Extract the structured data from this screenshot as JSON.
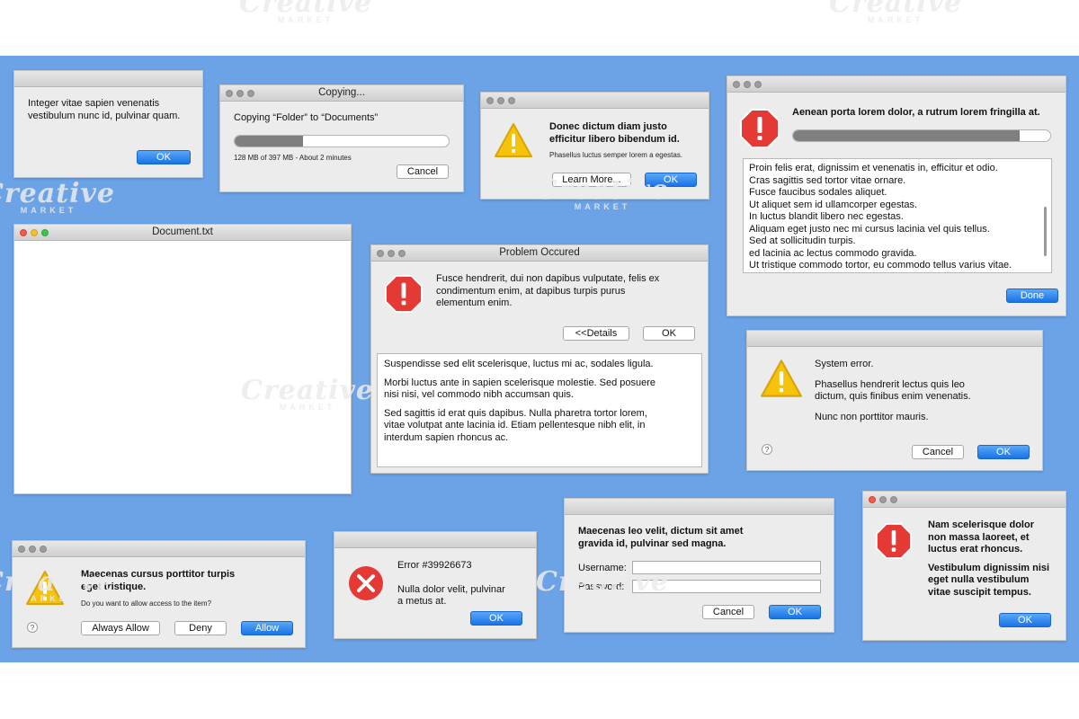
{
  "colors": {
    "background": "#6ca3e6",
    "accent_button": "#1a73e8",
    "error_red": "#e53935",
    "warning_yellow": "#f6c30b"
  },
  "watermark": {
    "brand": "Creative",
    "sub": "MARKET"
  },
  "d1": {
    "line1": "Integer vitae sapien venenatis",
    "line2": "vestibulum nunc id, pulvinar quam.",
    "ok": "OK"
  },
  "d2": {
    "title": "Copying...",
    "message": "Copying “Folder” to “Documents”",
    "status": "128 MB of 397 MB - About 2 minutes",
    "cancel": "Cancel",
    "progress_fraction": 0.32
  },
  "d3": {
    "line1": "Donec dictum diam justo",
    "line2": "efficitur libero bibendum id.",
    "detail": "Phasellus luctus semper lorem a egestas.",
    "learn_more": "Learn More...",
    "ok": "OK",
    "icon": "warning-icon"
  },
  "d4": {
    "title": "Aenean porta lorem dolor, a rutrum lorem fringilla at.",
    "progress_fraction": 0.88,
    "lines": [
      "Proin felis erat, dignissim et venenatis in, efficitur et odio.",
      "Cras sagittis sed tortor vitae ornare.",
      "Fusce faucibus sodales aliquet.",
      "Ut aliquet sem id ullamcorper egestas.",
      "In luctus blandit libero nec egestas.",
      "Aliquam eget justo nec mi cursus lacinia vel quis tellus.",
      "Sed at sollicitudin turpis.",
      "ed lacinia ac lectus commodo gravida.",
      "Ut tristique commodo tortor, eu commodo tellus varius vitae."
    ],
    "done": "Done",
    "icon": "error-icon"
  },
  "d5": {
    "title": "Document.txt"
  },
  "d6": {
    "title": "Problem Occured",
    "line1": "Fusce hendrerit, dui non dapibus vulputate, felis ex",
    "line2": "condimentum enim, at dapibus turpis purus",
    "line3": "elementum enim.",
    "details": "<<Details",
    "ok": "OK",
    "p1": "Suspendisse sed elit scelerisque, luctus mi ac, sodales ligula.",
    "p2a": "Morbi luctus ante in sapien scelerisque molestie. Sed posuere",
    "p2b": "nisi nisi, vel commodo nibh accumsan quis.",
    "p3a": "Sed sagittis id erat quis dapibus. Nulla pharetra tortor lorem,",
    "p3b": "vitae volutpat ante lacinia id. Etiam pellentesque nibh elit, in",
    "p3c": "interdum sapien rhoncus ac.",
    "icon": "error-icon"
  },
  "d7": {
    "heading": "System error.",
    "line1": "Phasellus hendrerit lectus quis leo",
    "line2": "dictum, quis finibus enim venenatis.",
    "line3": "Nunc non porttitor mauris.",
    "help": "?",
    "cancel": "Cancel",
    "ok": "OK",
    "icon": "warning-icon"
  },
  "d8": {
    "line1": "Maecenas cursus porttitor turpis",
    "line2": "eget tristique.",
    "question": "Do you want to allow access to the item?",
    "help": "?",
    "always_allow": "Always Allow",
    "deny": "Deny",
    "allow": "Allow",
    "icon": "warning-icon"
  },
  "d9": {
    "error_code": "Error #39926673",
    "line1": "Nulla dolor velit, pulvinar",
    "line2": "a metus at.",
    "ok": "OK",
    "icon": "error-x-icon"
  },
  "d10": {
    "line1": "Maecenas leo velit, dictum sit amet",
    "line2": "gravida id, pulvinar sed magna.",
    "username_label": "Username:",
    "password_label": "Password:",
    "username_value": "",
    "password_value": "",
    "cancel": "Cancel",
    "ok": "OK"
  },
  "d11": {
    "l1": "Nam scelerisque dolor",
    "l2": "non massa laoreet, et",
    "l3": "luctus erat rhoncus.",
    "l4": "Vestibulum dignissim nisi",
    "l5": "eget nulla vestibulum",
    "l6": "vitae suscipit tempus.",
    "ok": "OK",
    "icon": "error-icon"
  }
}
